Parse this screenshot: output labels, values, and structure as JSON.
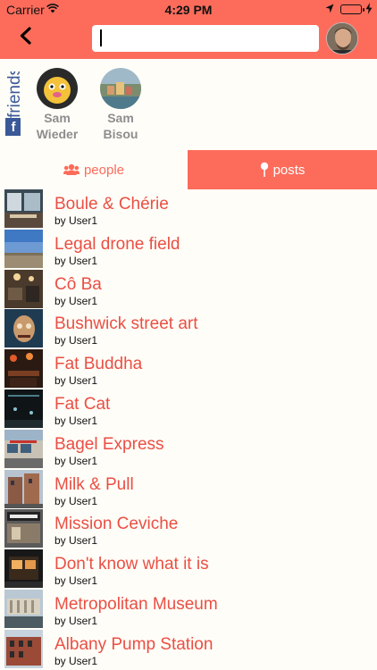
{
  "status_bar": {
    "carrier": "Carrier",
    "time": "4:29 PM"
  },
  "header": {
    "search_value": ""
  },
  "friends": {
    "label": "friends",
    "items": [
      {
        "first": "Sam",
        "last": "Wieder"
      },
      {
        "first": "Sam",
        "last": "Bisou"
      }
    ]
  },
  "tabs": {
    "people": "people",
    "posts": "posts",
    "active": "posts"
  },
  "colors": {
    "accent": "#fd6c5b",
    "title": "#ea4f43",
    "facebook": "#3b5998"
  },
  "posts": [
    {
      "title": "Boule & Chérie",
      "byline": "by User1",
      "thumb": "restaurant-window"
    },
    {
      "title": "Legal drone field",
      "byline": "by User1",
      "thumb": "field-sky"
    },
    {
      "title": "Cô Ba",
      "byline": "by User1",
      "thumb": "restaurant-interior"
    },
    {
      "title": "Bushwick street art",
      "byline": "by User1",
      "thumb": "mural-face"
    },
    {
      "title": "Fat Buddha",
      "byline": "by User1",
      "thumb": "bar-interior"
    },
    {
      "title": "Fat Cat",
      "byline": "by User1",
      "thumb": "dark-club"
    },
    {
      "title": "Bagel Express",
      "byline": "by User1",
      "thumb": "storefront"
    },
    {
      "title": "Milk & Pull",
      "byline": "by User1",
      "thumb": "street-building"
    },
    {
      "title": "Mission Ceviche",
      "byline": "by User1",
      "thumb": "restaurant-sign"
    },
    {
      "title": "Don't know what it is",
      "byline": "by User1",
      "thumb": "shop-night"
    },
    {
      "title": "Metropolitan Museum",
      "byline": "by User1",
      "thumb": "museum-crowd"
    },
    {
      "title": "Albany Pump Station",
      "byline": "by User1",
      "thumb": "brick-building"
    }
  ]
}
